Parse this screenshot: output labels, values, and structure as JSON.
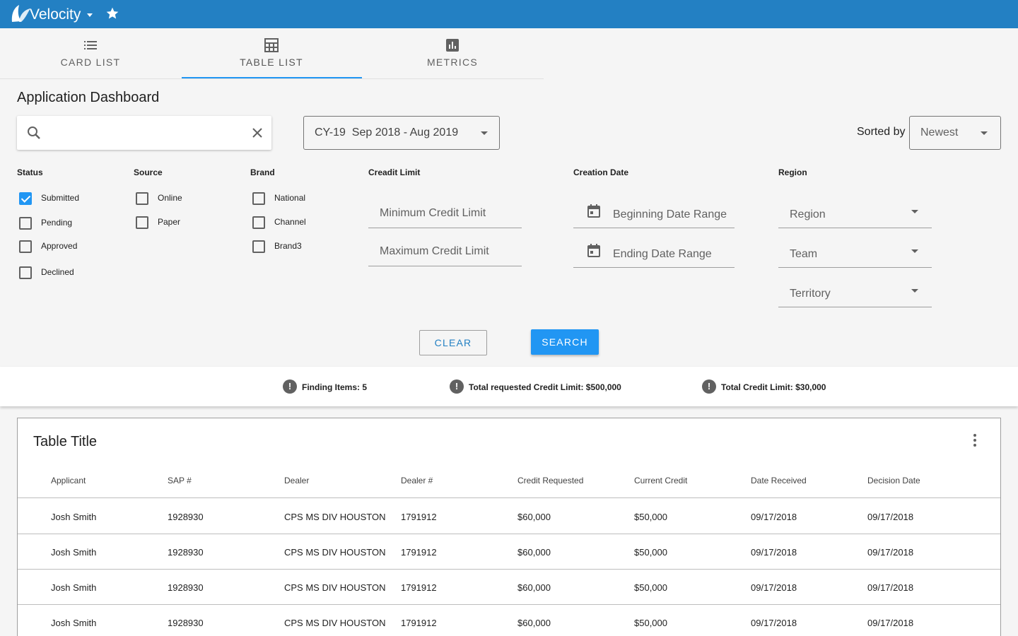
{
  "app": {
    "name": "Velocity",
    "logo_icon": "leaf-logo-icon",
    "favorite_icon": "star-icon"
  },
  "tabs": [
    {
      "label": "CARD LIST",
      "icon": "list-icon"
    },
    {
      "label": "TABLE LIST",
      "icon": "table-grid-icon",
      "active": true
    },
    {
      "label": "METRICS",
      "icon": "bar-chart-icon"
    }
  ],
  "page": {
    "title": "Application Dashboard"
  },
  "search": {
    "value": "",
    "placeholder": ""
  },
  "period": {
    "value": "CY-19  Sep 2018 - Aug 2019"
  },
  "sort": {
    "label": "Sorted by",
    "value": "Newest"
  },
  "filters": {
    "status": {
      "title": "Status",
      "options": [
        {
          "label": "Submitted",
          "checked": true
        },
        {
          "label": "Pending",
          "checked": false
        },
        {
          "label": "Approved",
          "checked": false
        },
        {
          "label": "Declined",
          "checked": false
        }
      ]
    },
    "source": {
      "title": "Source",
      "options": [
        {
          "label": "Online",
          "checked": false
        },
        {
          "label": "Paper",
          "checked": false
        }
      ]
    },
    "brand": {
      "title": "Brand",
      "options": [
        {
          "label": "National",
          "checked": false
        },
        {
          "label": "Channel",
          "checked": false
        },
        {
          "label": "Brand3",
          "checked": false
        }
      ]
    },
    "credit_limit": {
      "title": "Creadit Limit",
      "min_placeholder": "Minimum Credit Limit",
      "max_placeholder": "Maximum Credit Limit"
    },
    "creation_date": {
      "title": "Creation Date",
      "begin_placeholder": "Beginning Date Range",
      "end_placeholder": "Ending Date Range"
    },
    "region": {
      "title": "Region",
      "selects": [
        "Region",
        "Team",
        "Territory"
      ]
    }
  },
  "actions": {
    "clear": "CLEAR",
    "search": "SEARCH"
  },
  "summary": [
    {
      "text": "Finding Items: 5"
    },
    {
      "text": "Total requested Credit Limit: $500,000"
    },
    {
      "text": "Total Credit Limit: $30,000"
    }
  ],
  "summary_icon_glyph": "!",
  "table": {
    "title": "Table Title",
    "columns": [
      "Applicant",
      "SAP #",
      "Dealer",
      "Dealer #",
      "Credit Requested",
      "Current Credit",
      "Date Received",
      "Decision Date"
    ],
    "rows": [
      [
        "Josh Smith",
        "1928930",
        "CPS MS DIV HOUSTON",
        "1791912",
        "$60,000",
        "$50,000",
        "09/17/2018",
        "09/17/2018"
      ],
      [
        "Josh Smith",
        "1928930",
        "CPS MS DIV HOUSTON",
        "1791912",
        "$60,000",
        "$50,000",
        "09/17/2018",
        "09/17/2018"
      ],
      [
        "Josh Smith",
        "1928930",
        "CPS MS DIV HOUSTON",
        "1791912",
        "$60,000",
        "$50,000",
        "09/17/2018",
        "09/17/2018"
      ],
      [
        "Josh Smith",
        "1928930",
        "CPS MS DIV HOUSTON",
        "1791912",
        "$60,000",
        "$50,000",
        "09/17/2018",
        "09/17/2018"
      ]
    ]
  },
  "colors": {
    "appbar": "#2380c3",
    "accent": "#2196f3"
  }
}
